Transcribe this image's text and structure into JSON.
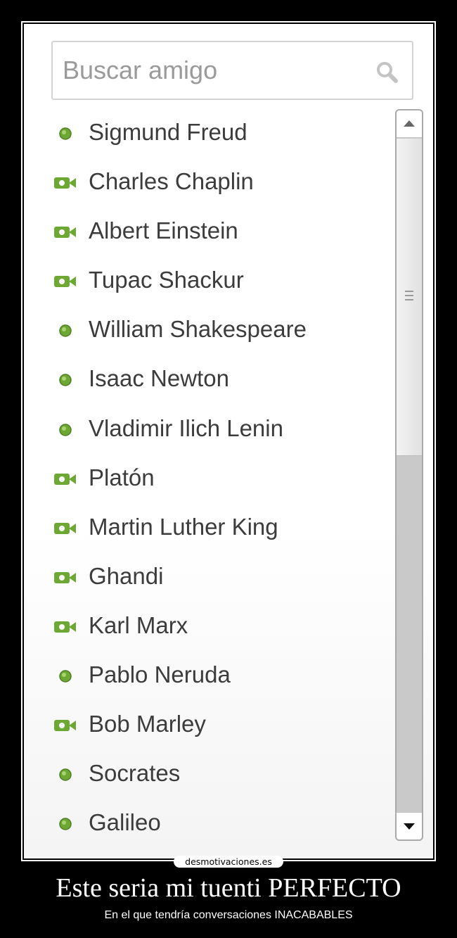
{
  "search": {
    "placeholder": "Buscar amigo",
    "icon": "search-icon"
  },
  "colors": {
    "online": "#6ea834",
    "frame": "#ffffff",
    "background": "#000000"
  },
  "friends": [
    {
      "name": "Sigmund Freud",
      "status": "online"
    },
    {
      "name": "Charles Chaplin",
      "status": "video"
    },
    {
      "name": "Albert Einstein",
      "status": "video"
    },
    {
      "name": "Tupac Shackur",
      "status": "video"
    },
    {
      "name": "William Shakespeare",
      "status": "online"
    },
    {
      "name": "Isaac Newton",
      "status": "online"
    },
    {
      "name": "Vladimir Ilich Lenin",
      "status": "online"
    },
    {
      "name": "Platón",
      "status": "video"
    },
    {
      "name": "Martin Luther King",
      "status": "video"
    },
    {
      "name": "Ghandi",
      "status": "video"
    },
    {
      "name": "Karl Marx",
      "status": "video"
    },
    {
      "name": "Pablo Neruda",
      "status": "online"
    },
    {
      "name": "Bob Marley",
      "status": "video"
    },
    {
      "name": "Socrates",
      "status": "online"
    },
    {
      "name": "Galileo",
      "status": "online"
    }
  ],
  "scrollbar": {
    "position": 0
  },
  "watermark": "desmotivaciones.es",
  "poster": {
    "title": "Este seria mi tuenti PERFECTO",
    "subtitle": "En el que tendría conversaciones INACABABLES"
  }
}
